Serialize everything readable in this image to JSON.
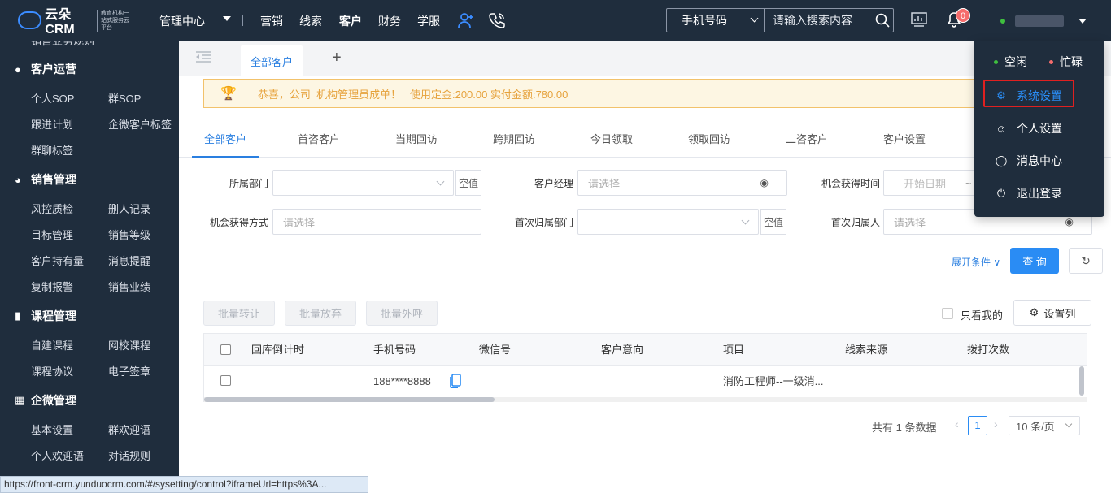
{
  "topbar": {
    "brand": "云朵CRM",
    "slogan": "教育机构一站式服务云平台",
    "nav": [
      "管理中心",
      "营销",
      "线索",
      "客户",
      "财务",
      "学服"
    ],
    "search_type": "手机号码",
    "search_placeholder": "请输入搜索内容",
    "notification_count": "0"
  },
  "sidebar": {
    "groups": [
      {
        "title": "客户运营",
        "icon": "user-icon",
        "items": [
          "个人SOP",
          "群SOP",
          "跟进计划",
          "企微客户标签",
          "群聊标签"
        ]
      },
      {
        "title": "销售管理",
        "icon": "pie-chart-icon",
        "items": [
          "风控质检",
          "删人记录",
          "目标管理",
          "销售等级",
          "客户持有量",
          "消息提醒",
          "复制报警",
          "销售业绩"
        ]
      },
      {
        "title": "课程管理",
        "icon": "book-icon",
        "items": [
          "自建课程",
          "网校课程",
          "课程协议",
          "电子签章"
        ]
      },
      {
        "title": "企微管理",
        "icon": "building-icon",
        "items": [
          "基本设置",
          "群欢迎语",
          "个人欢迎语",
          "对话规则"
        ]
      }
    ]
  },
  "tabs": {
    "active": "全部客户",
    "add": "+"
  },
  "banner": {
    "text": "恭喜，公司  机构管理员成单！   使用定金:200.00 实付金额:780.00"
  },
  "subtabs": [
    "全部客户",
    "首咨客户",
    "当期回访",
    "跨期回访",
    "今日领取",
    "领取回访",
    "二咨客户",
    "客户设置"
  ],
  "filters": {
    "dept_label": "所属部门",
    "clear": "空值",
    "manager_label": "客户经理",
    "select_placeholder": "请选择",
    "opp_time_label": "机会获得时间",
    "start_date": "开始日期",
    "date_sep": "~",
    "opp_method_label": "机会获得方式",
    "first_dept_label": "首次归属部门",
    "first_owner_label": "首次归属人",
    "expand": "展开条件",
    "query": "查 询"
  },
  "batch": {
    "transfer": "批量转让",
    "abandon": "批量放弃",
    "call": "批量外呼",
    "only_mine": "只看我的",
    "columns": "设置列"
  },
  "table": {
    "headers": [
      "回库倒计时",
      "手机号码",
      "微信号",
      "客户意向",
      "项目",
      "线索来源",
      "拨打次数"
    ],
    "rows": [
      {
        "phone": "188****8888",
        "project": "消防工程师--一级消..."
      }
    ]
  },
  "pagination": {
    "total": "共有 1 条数据",
    "page": "1",
    "page_size": "10 条/页"
  },
  "dropdown": {
    "idle": "空闲",
    "busy": "忙碌",
    "items": [
      {
        "label": "系统设置",
        "icon": "gear-icon"
      },
      {
        "label": "个人设置",
        "icon": "user-icon"
      },
      {
        "label": "消息中心",
        "icon": "message-icon"
      },
      {
        "label": "退出登录",
        "icon": "power-icon"
      }
    ]
  },
  "status_url": "https://front-crm.yunduocrm.com/#/sysetting/control?iframeUrl=https%3A..."
}
